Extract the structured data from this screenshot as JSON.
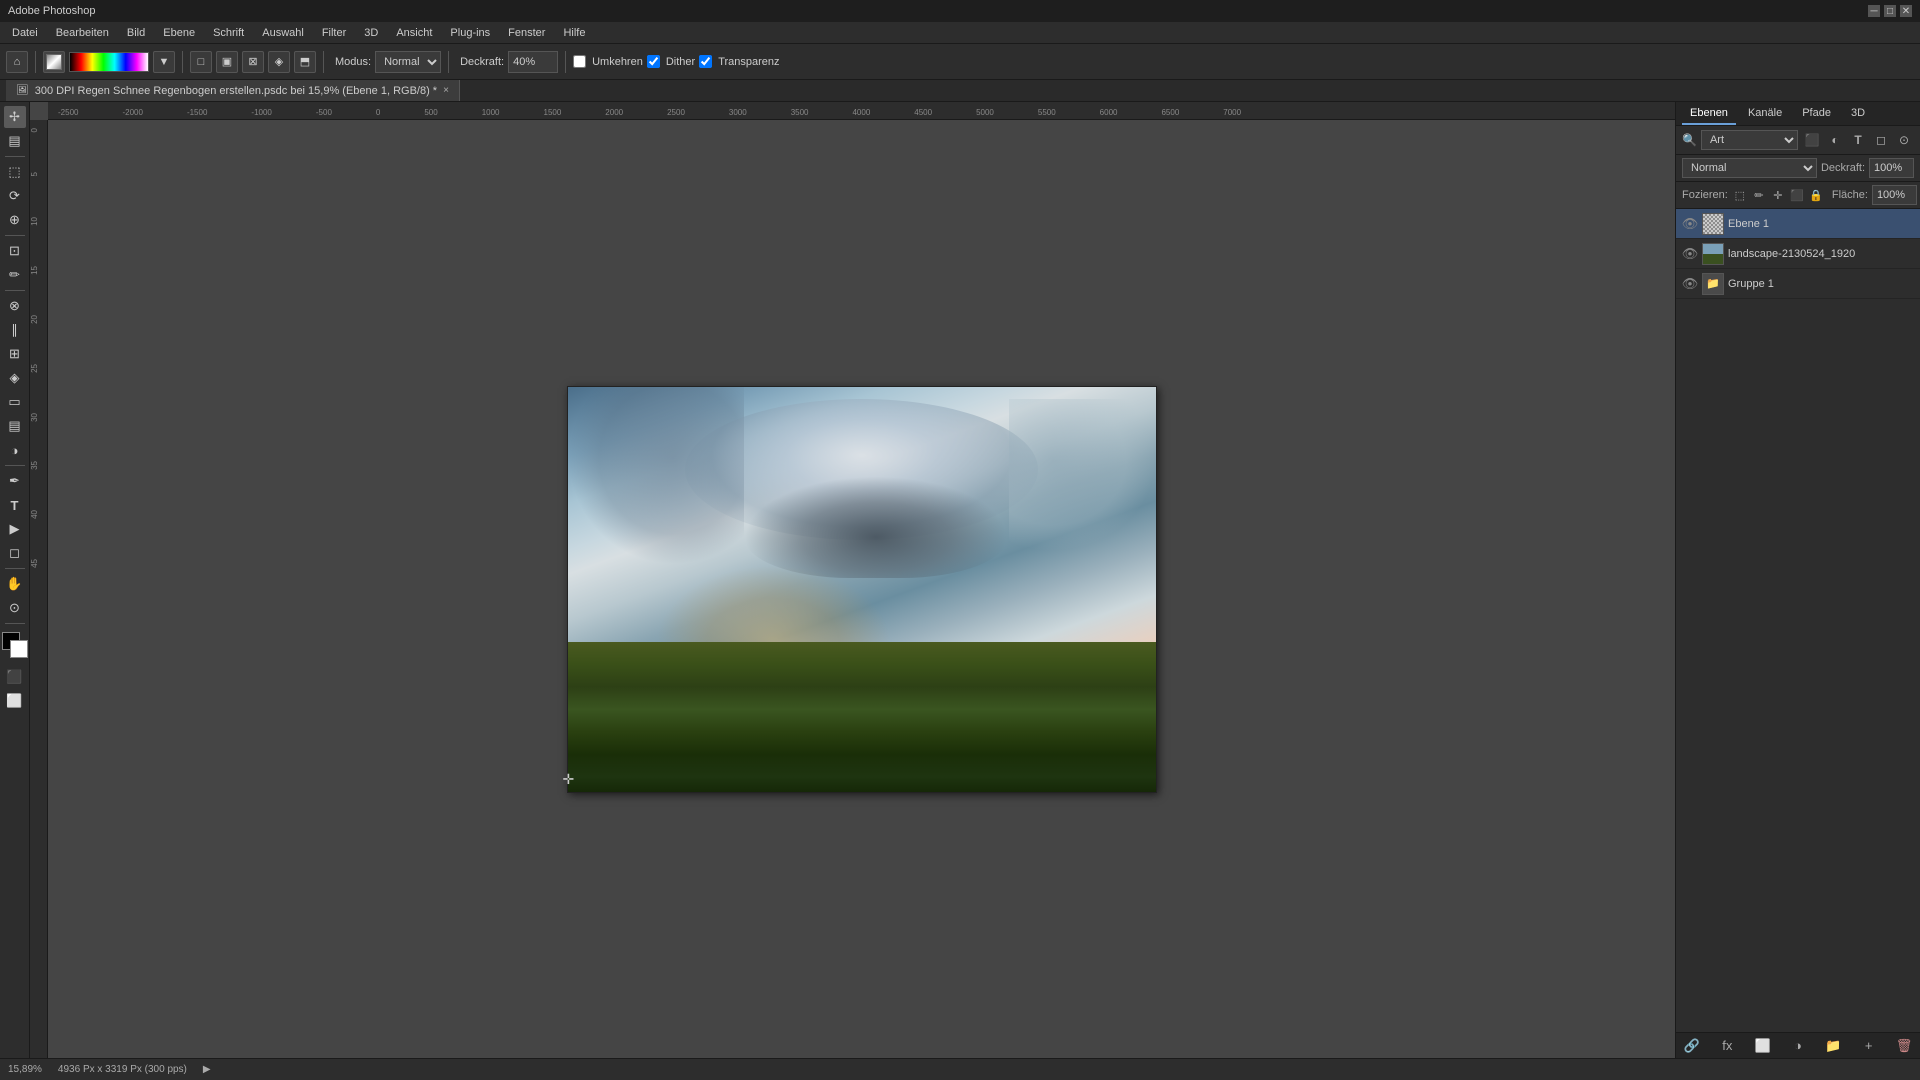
{
  "titlebar": {
    "title": "Adobe Photoshop",
    "controls": [
      "minimize",
      "maximize",
      "close"
    ]
  },
  "menubar": {
    "items": [
      "Datei",
      "Bearbeiten",
      "Bild",
      "Ebene",
      "Schrift",
      "Auswahl",
      "Filter",
      "3D",
      "Ansicht",
      "Plug-ins",
      "Fenster",
      "Hilfe"
    ]
  },
  "toolbar": {
    "home_icon": "⌂",
    "mode_label": "Modus:",
    "mode_value": "Normal",
    "opacity_label": "Deckraft:",
    "opacity_value": "40%",
    "invert_label": "Umkehren",
    "dither_label": "Dither",
    "transparency_label": "Transparenz"
  },
  "doc_tab": {
    "title": "300 DPI Regen Schnee Regenbogen erstellen.psdc bei 15,9% (Ebene 1, RGB/8) *",
    "close": "×"
  },
  "canvas": {
    "zoom": "15,89%",
    "dimensions": "4936 Px x 3319 Px (300 pps)"
  },
  "ruler": {
    "top_marks": [
      "-2500",
      "-2000",
      "-1500",
      "-1000",
      "-500",
      "0",
      "500",
      "1000",
      "1500",
      "2000",
      "2500",
      "3000",
      "3500",
      "4000",
      "4500",
      "5000",
      "5500",
      "6000",
      "6500",
      "7000"
    ],
    "left_marks": [
      "0",
      "5",
      "10",
      "15",
      "20",
      "25",
      "30",
      "35",
      "40",
      "45"
    ]
  },
  "right_panel": {
    "tabs": [
      "Ebenen",
      "Kanäle",
      "Pfade",
      "3D"
    ],
    "active_tab": "Ebenen",
    "search_placeholder": "Art",
    "blend_mode": "Normal",
    "opacity_label": "Deckraft:",
    "opacity_value": "100%",
    "fill_label": "Fläche:",
    "fill_value": "100%",
    "foci_label": "Fozieren:",
    "layers": [
      {
        "name": "Ebene 1",
        "visible": true,
        "type": "normal",
        "active": true
      },
      {
        "name": "landscape-2130524_1920",
        "visible": true,
        "type": "image",
        "active": false
      },
      {
        "name": "Gruppe 1",
        "visible": true,
        "type": "group",
        "active": false
      }
    ]
  },
  "statusbar": {
    "zoom": "15,89%",
    "dimensions": "4936 Px x 3319 Px (300 pps)"
  },
  "tools": [
    {
      "id": "move",
      "icon": "✢",
      "label": "move-tool"
    },
    {
      "id": "select-rect",
      "icon": "⬚",
      "label": "rectangular-marquee-tool"
    },
    {
      "id": "lasso",
      "icon": "⟳",
      "label": "lasso-tool"
    },
    {
      "id": "quick-sel",
      "icon": "⊕",
      "label": "quick-selection-tool"
    },
    {
      "id": "crop",
      "icon": "⊡",
      "label": "crop-tool"
    },
    {
      "id": "eyedropper",
      "icon": "✏",
      "label": "eyedropper-tool"
    },
    {
      "id": "spot-heal",
      "icon": "⊗",
      "label": "spot-healing-tool"
    },
    {
      "id": "brush",
      "icon": "∥",
      "label": "brush-tool"
    },
    {
      "id": "clone",
      "icon": "⊞",
      "label": "clone-stamp-tool"
    },
    {
      "id": "history",
      "icon": "◈",
      "label": "history-brush-tool"
    },
    {
      "id": "eraser",
      "icon": "▭",
      "label": "eraser-tool"
    },
    {
      "id": "gradient",
      "icon": "▤",
      "label": "gradient-tool"
    },
    {
      "id": "dodge",
      "icon": "◑",
      "label": "dodge-tool"
    },
    {
      "id": "pen",
      "icon": "✒",
      "label": "pen-tool"
    },
    {
      "id": "text",
      "icon": "T",
      "label": "text-tool"
    },
    {
      "id": "path-sel",
      "icon": "▶",
      "label": "path-selection-tool"
    },
    {
      "id": "shape",
      "icon": "◻",
      "label": "shape-tool"
    },
    {
      "id": "hand",
      "icon": "✋",
      "label": "hand-tool"
    },
    {
      "id": "zoom",
      "icon": "⊙",
      "label": "zoom-tool"
    }
  ]
}
